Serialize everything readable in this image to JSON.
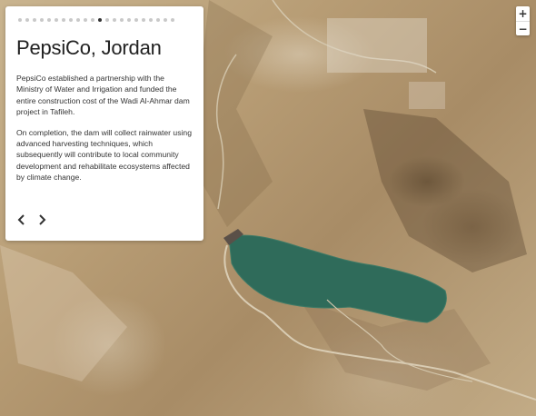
{
  "story": {
    "title": "PepsiCo, Jordan",
    "paragraphs": [
      "PepsiCo established a partnership with the Ministry of Water and Irrigation and funded the entire construction cost of the Wadi Al-Ahmar dam project in Tafileh.",
      "On completion, the dam will collect rainwater using advanced harvesting techniques, which subsequently will contribute to local community development and rehabilitate ecosystems affected by climate change."
    ],
    "progress": {
      "total": 22,
      "current": 12
    },
    "prev_icon": "chevron-left-icon",
    "next_icon": "chevron-right-icon"
  },
  "map": {
    "zoom_in_label": "+",
    "zoom_out_label": "−",
    "water_color": "#2f6b5a",
    "terrain_color": "#b79c74"
  }
}
